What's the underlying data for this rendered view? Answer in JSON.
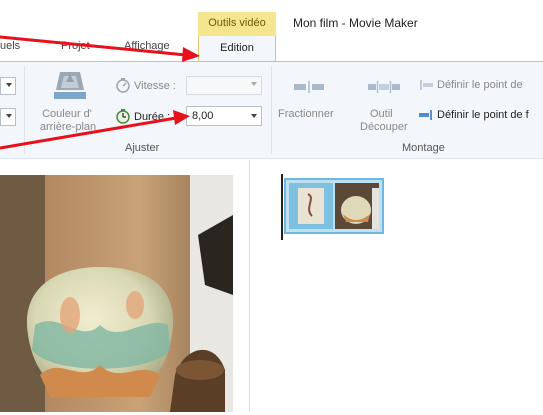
{
  "window": {
    "contextual_tab_group": "Outils vidéo",
    "title": "Mon film - Movie Maker"
  },
  "tabs": [
    {
      "label": "uels"
    },
    {
      "label": "Projet"
    },
    {
      "label": "Affichage"
    },
    {
      "label": "Edition",
      "active": true
    }
  ],
  "ribbon": {
    "ajuster": {
      "background_color_label_1": "Couleur d'",
      "background_color_label_2": "arrière-plan",
      "speed_label": "Vitesse :",
      "speed_value": "",
      "duration_label": "Durée :",
      "duration_value": "8,00",
      "group_label": "Ajuster"
    },
    "montage": {
      "split_label": "Fractionner",
      "trim_label_1": "Outil",
      "trim_label_2": "Découper",
      "set_start_label": "Définir le point de",
      "set_end_label": "Définir le point de f",
      "group_label": "Montage"
    }
  },
  "colors": {
    "annotation_arrow": "#e8101a",
    "contextual_tab": "#f4e58f",
    "clip_border": "#6fb6e0"
  }
}
